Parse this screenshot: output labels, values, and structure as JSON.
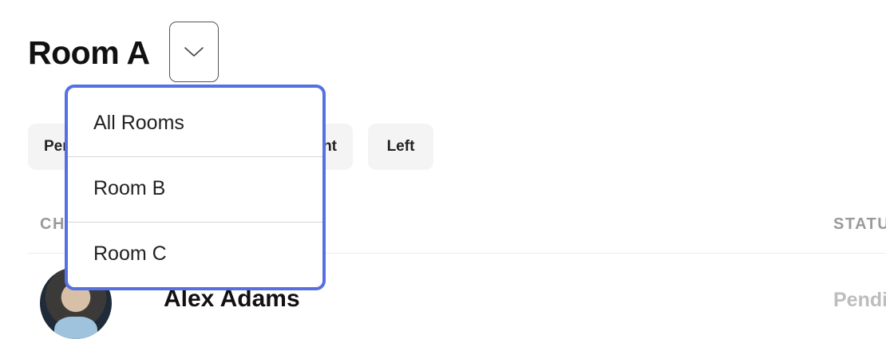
{
  "header": {
    "room_title": "Room A",
    "toggle_icon": "chevron-down-icon"
  },
  "filters": [
    {
      "label": "Pending"
    },
    {
      "label": "Present"
    },
    {
      "label": "Left"
    }
  ],
  "table": {
    "columns": [
      "CHILD",
      "STATUS"
    ],
    "rows": [
      {
        "name": "Alex Adams",
        "status": "Pending",
        "avatar": "child-photo"
      }
    ]
  },
  "room_dropdown": {
    "options": [
      {
        "label": "All Rooms"
      },
      {
        "label": "Room B"
      },
      {
        "label": "Room C"
      }
    ],
    "border_color": "#5470e3"
  }
}
